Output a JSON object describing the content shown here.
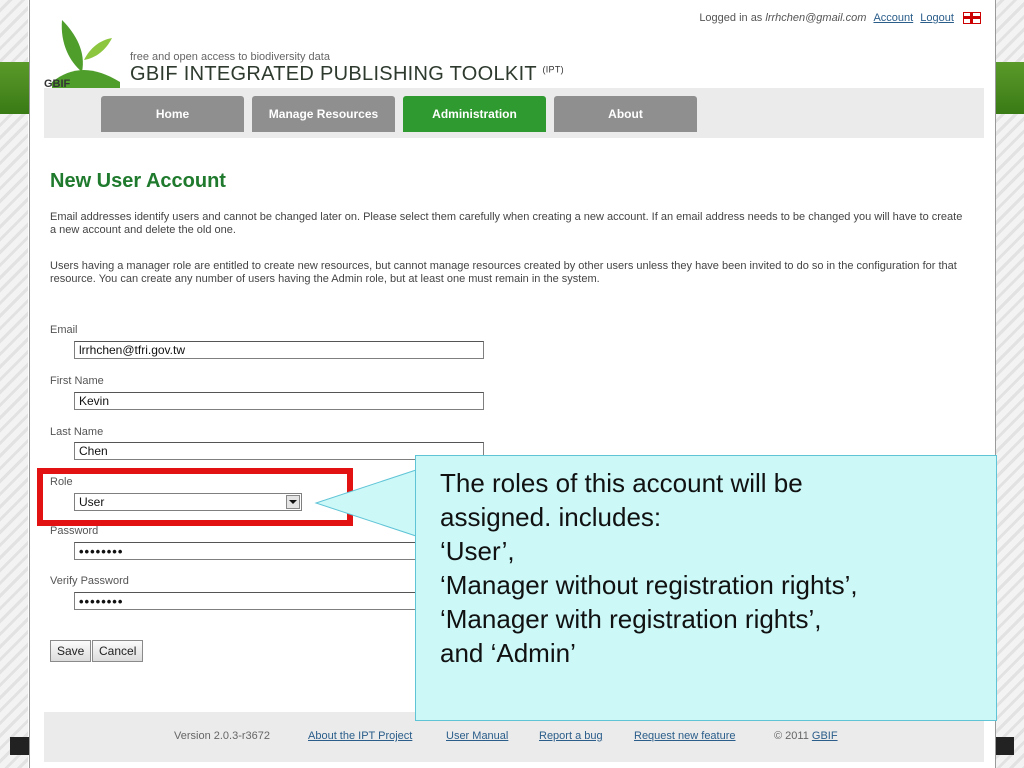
{
  "topbar": {
    "logged_in_prefix": "Logged in as",
    "user_email": "lrrhchen@gmail.com",
    "account_link": "Account",
    "logout_link": "Logout"
  },
  "branding": {
    "logo_text": "GBIF",
    "tagline": "free and open access to biodiversity data",
    "product_title": "GBIF INTEGRATED PUBLISHING TOOLKIT",
    "product_suffix": "(IPT)"
  },
  "nav": {
    "tabs": [
      {
        "label": "Home",
        "active": false
      },
      {
        "label": "Manage Resources",
        "active": false
      },
      {
        "label": "Administration",
        "active": true
      },
      {
        "label": "About",
        "active": false
      }
    ]
  },
  "page": {
    "title": "New User Account",
    "intro_1": "Email addresses identify users and cannot be changed later on. Please select them carefully when creating a new account. If an email address needs to be changed you will have to create a new account and delete the old one.",
    "intro_2": "Users having a manager role are entitled to create new resources, but cannot manage resources created by other users unless they have been invited to do so in the configuration for that resource. You can create any number of users having the Admin role, but at least one must remain in the system."
  },
  "form": {
    "email_label": "Email",
    "email_value": "lrrhchen@tfri.gov.tw",
    "first_name_label": "First Name",
    "first_name_value": "Kevin",
    "last_name_label": "Last Name",
    "last_name_value": "Chen",
    "role_label": "Role",
    "role_value": "User",
    "password_label": "Password",
    "password_value": "••••••••",
    "verify_password_label": "Verify Password",
    "verify_password_value": "••••••••",
    "save_label": "Save",
    "cancel_label": "Cancel"
  },
  "callout": {
    "lines": [
      "The roles of this account will be",
      "assigned. includes:",
      "‘User’,",
      "‘Manager without registration rights’,",
      "‘Manager with registration rights’,",
      "and ‘Admin’"
    ]
  },
  "footer": {
    "version": "Version 2.0.3-r3672",
    "links": [
      "About the IPT Project",
      "User Manual",
      "Report a bug",
      "Request new feature"
    ],
    "copyright": "© 2011",
    "copyright_link": "GBIF"
  },
  "colors": {
    "accent_green": "#2f9a2f",
    "heading_green": "#1f7a2d",
    "highlight_red": "#e31212",
    "callout_bg": "#ccf8f8",
    "nav_gray": "#8f8f8f"
  }
}
